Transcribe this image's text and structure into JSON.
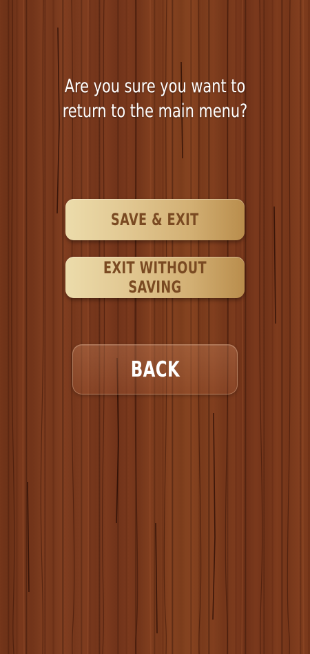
{
  "dialog": {
    "prompt_line1": "Are you sure you want to",
    "prompt_line2": "return to the main menu?"
  },
  "buttons": {
    "save_exit_label": "SAVE & EXIT",
    "exit_without_saving_label": "EXIT WITHOUT SAVING",
    "back_label": "BACK"
  },
  "colors": {
    "background_wood": "#7a3a1f",
    "gold_button_light": "#ecdcab",
    "gold_button_dark": "#b98d4c",
    "gold_button_text": "#7a4a22",
    "prompt_text": "#ffffff"
  }
}
